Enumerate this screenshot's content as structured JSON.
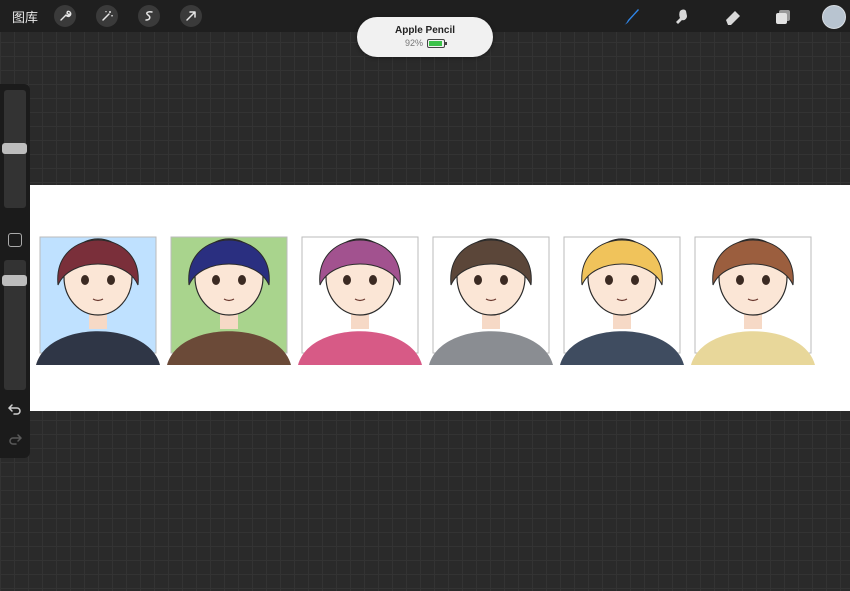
{
  "topbar": {
    "gallery_label": "图库",
    "tools_left": [
      {
        "name": "wrench-icon"
      },
      {
        "name": "magic-wand-icon"
      },
      {
        "name": "selection-icon"
      },
      {
        "name": "transform-arrow-icon"
      }
    ],
    "tools_right": [
      {
        "name": "brush-icon",
        "color": "#2f86e8"
      },
      {
        "name": "smudge-icon",
        "color": "#d9d9d9"
      },
      {
        "name": "eraser-icon",
        "color": "#d9d9d9"
      },
      {
        "name": "layers-icon",
        "color": "#d9d9d9"
      }
    ],
    "current_color": "#b8c4d0"
  },
  "pencil": {
    "title": "Apple Pencil",
    "battery_text": "92%",
    "battery_level": 0.92,
    "battery_color": "#3cc24a"
  },
  "sidebar": {
    "brush_size_level": 0.5,
    "opacity_level": 0.9
  },
  "canvas": {
    "background": "#ffffff",
    "characters": [
      {
        "hair": "#7a2f3a",
        "bg": "#bfe1ff",
        "clothes": "#2f3646"
      },
      {
        "hair": "#2a2f80",
        "bg": "#a9d48d",
        "clothes": "#6b4a38"
      },
      {
        "hair": "#a2528f",
        "bg": "#ffffff",
        "clothes": "#d75a86"
      },
      {
        "hair": "#5b4639",
        "bg": "#ffffff",
        "clothes": "#8a8d92"
      },
      {
        "hair": "#f0c35b",
        "bg": "#ffffff",
        "clothes": "#3f4c60"
      },
      {
        "hair": "#9b5e3e",
        "bg": "#ffffff",
        "clothes": "#e8d79a"
      }
    ]
  }
}
